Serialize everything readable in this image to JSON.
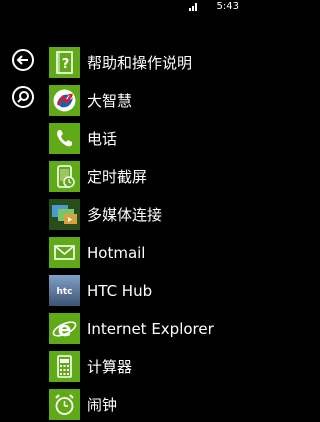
{
  "status_bar": {
    "time": "5:43"
  },
  "side_controls": {
    "back_icon": "back-arrow-icon",
    "search_icon": "search-icon"
  },
  "accent_color": "#60a917",
  "apps": [
    {
      "label": "帮助和操作说明",
      "icon": "help-question-icon"
    },
    {
      "label": "大智慧",
      "icon": "dazhihui-logo-icon"
    },
    {
      "label": "电话",
      "icon": "phone-icon"
    },
    {
      "label": "定时截屏",
      "icon": "timed-screenshot-icon"
    },
    {
      "label": "多媒体连接",
      "icon": "media-connect-icon"
    },
    {
      "label": "Hotmail",
      "icon": "hotmail-icon"
    },
    {
      "label": "HTC Hub",
      "icon": "htc-hub-icon"
    },
    {
      "label": "Internet Explorer",
      "icon": "internet-explorer-icon"
    },
    {
      "label": "计算器",
      "icon": "calculator-icon"
    },
    {
      "label": "闹钟",
      "icon": "alarm-clock-icon"
    }
  ]
}
